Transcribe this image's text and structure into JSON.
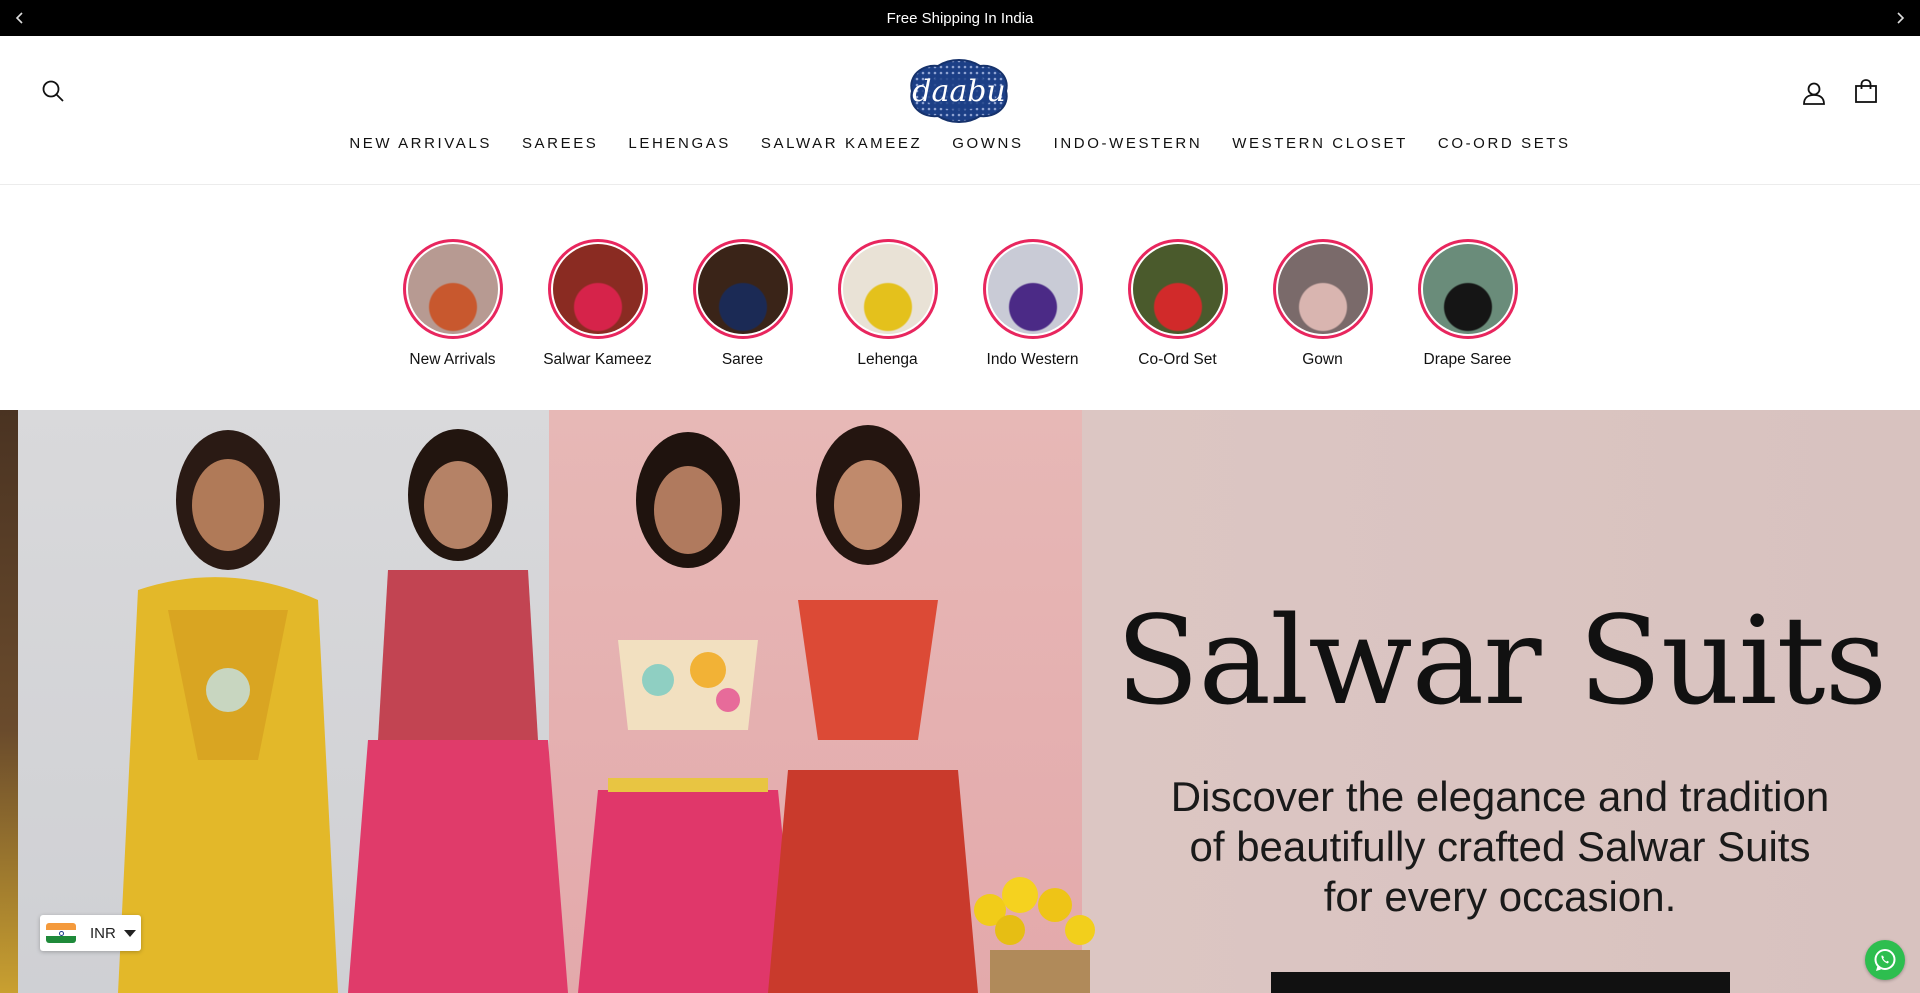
{
  "announcement": {
    "text": "Free Shipping In India",
    "prev_icon": "chevron-left-icon",
    "next_icon": "chevron-right-icon"
  },
  "header": {
    "logo_text": "daabu",
    "search_icon": "search-icon",
    "account_icon": "user-icon",
    "cart_icon": "shopping-bag-icon"
  },
  "nav": {
    "items": [
      {
        "label": "NEW ARRIVALS"
      },
      {
        "label": "SAREES"
      },
      {
        "label": "LEHENGAS"
      },
      {
        "label": "SALWAR KAMEEZ"
      },
      {
        "label": "GOWNS"
      },
      {
        "label": "INDO-WESTERN"
      },
      {
        "label": "WESTERN CLOSET"
      },
      {
        "label": "CO-ORD SETS"
      }
    ]
  },
  "categories": {
    "ring_color": "#e8265e",
    "items": [
      {
        "label": "New Arrivals",
        "bg": "#b79a92",
        "fg": "#c8582e"
      },
      {
        "label": "Salwar Kameez",
        "bg": "#8a2b22",
        "fg": "#d6234a"
      },
      {
        "label": "Saree",
        "bg": "#3a2418",
        "fg": "#1b2a55"
      },
      {
        "label": "Lehenga",
        "bg": "#e9e2d6",
        "fg": "#e4c11c"
      },
      {
        "label": "Indo Western",
        "bg": "#c9cbd6",
        "fg": "#4b2a86"
      },
      {
        "label": "Co-Ord Set",
        "bg": "#4a5a2c",
        "fg": "#d12a2a"
      },
      {
        "label": "Gown",
        "bg": "#7a6a6a",
        "fg": "#d9b5b0"
      },
      {
        "label": "Drape Saree",
        "bg": "#6a8c7a",
        "fg": "#151515"
      }
    ]
  },
  "hero": {
    "title": "Salwar Suits",
    "subtitle_lines": [
      "Discover the elegance and tradition",
      "of beautifully crafted Salwar Suits",
      "for every occasion."
    ]
  },
  "currency": {
    "code": "INR",
    "flag_colors": [
      "#f49a3c",
      "#ffffff",
      "#1f8a3a"
    ]
  },
  "whatsapp": {
    "icon": "whatsapp-icon",
    "color": "#2dbe4f"
  }
}
